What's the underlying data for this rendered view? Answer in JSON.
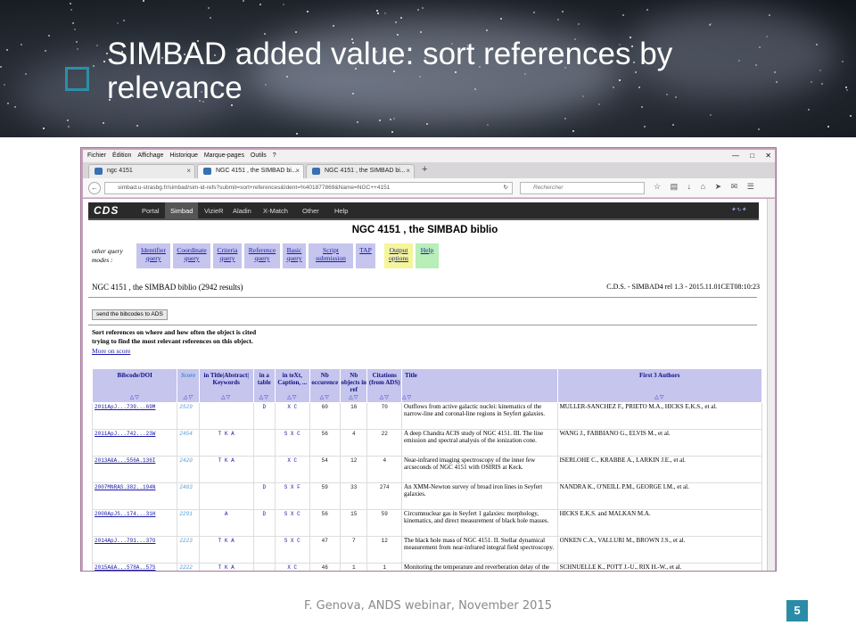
{
  "slide": {
    "title": "SIMBAD added value: sort references by relevance",
    "footer": "F. Genova, ANDS webinar, November 2015",
    "page_number": "5"
  },
  "browser": {
    "menu": [
      "Fichier",
      "Édition",
      "Affichage",
      "Historique",
      "Marque-pages",
      "Outils",
      "?"
    ],
    "tabs": [
      {
        "label": "ngc 4151",
        "active": false
      },
      {
        "label": "NGC 4151 , the SIMBAD bi...",
        "active": true
      },
      {
        "label": "NGC 4151 , the SIMBAD bi...",
        "active": false
      }
    ],
    "url": "simbad.u-strasbg.fr/simbad/sim-id-refs?submit=sort+references&Ident=%401877869&Name=NGC++4151",
    "search_placeholder": "Rechercher"
  },
  "simbad": {
    "logo": "CDS",
    "nav": [
      "Portal",
      "Simbad",
      "VizieR",
      "Aladin",
      "X-Match",
      "Other",
      "Help"
    ],
    "page_title": "NGC 4151 , the SIMBAD biblio",
    "other_modes_label": "other query modes :",
    "query_modes": [
      {
        "label": "Identifier query",
        "color": "#c5c5ee"
      },
      {
        "label": "Coordinate query",
        "color": "#c5c5ee"
      },
      {
        "label": "Criteria query",
        "color": "#c5c5ee"
      },
      {
        "label": "Reference query",
        "color": "#c5c5ee"
      },
      {
        "label": "Basic query",
        "color": "#c5c5ee"
      },
      {
        "label": "Script submission",
        "color": "#c5c5ee"
      },
      {
        "label": "TAP",
        "color": "#c5c5ee"
      },
      {
        "label": "Output options",
        "color": "#f5f59a"
      },
      {
        "label": "Help",
        "color": "#b8eeb8"
      }
    ],
    "result_heading": "NGC 4151 , the SIMBAD biblio (2942 results)",
    "version": "C.D.S. - SIMBAD4 rel 1.3 - 2015.11.01CET08:10:23",
    "ads_button": "send the bibcodes to ADS",
    "sort_note_1": "Sort references on where and how often the object is cited",
    "sort_note_2": "trying to find the most relevant references on this object.",
    "more_on_score": "More on score",
    "columns": [
      "Bibcode/DOI",
      "Score",
      "in Title|Abstract| Keywords",
      "in a table",
      "in teXt, Caption, ...",
      "Nb occurence",
      "Nb objects in ref",
      "Citations (from ADS)",
      "Title",
      "First 3 Authors"
    ],
    "sort_arrows": "△▽",
    "rows": [
      {
        "bibcode": "2011ApJ...739...69M",
        "score": "2529",
        "tak": "",
        "table": "D",
        "xc": "X C",
        "occ": "60",
        "objs": "16",
        "cit": "70",
        "title": "Outflows from active galactic nuclei: kinematics of the narrow-line and coronal-line regions in Seyfert galaxies.",
        "authors": "MULLER-SANCHEZ F., PRIETO M.A., HICKS E.K.S., et al."
      },
      {
        "bibcode": "2011ApJ...742...23W",
        "score": "2454",
        "tak": "T K A",
        "table": "",
        "xc": "S X C",
        "occ": "56",
        "objs": "4",
        "cit": "22",
        "title": "A deep Chandra ACIS study of NGC 4151. III. The line emission and spectral analysis of the ionization cone.",
        "authors": "WANG J., FABBIANO G., ELVIS M., et al."
      },
      {
        "bibcode": "2013A&A...556A.136I",
        "score": "2420",
        "tak": "T K A",
        "table": "",
        "xc": "X C",
        "occ": "54",
        "objs": "12",
        "cit": "4",
        "title": "Near-infrared imaging spectroscopy of the inner few arcseconds of NGC 4151 with OSIRIS at Keck.",
        "authors": "ISERLOHE C., KRABBE A., LARKIN J.E., et al."
      },
      {
        "bibcode": "2007MNRAS.382..194N",
        "score": "2403",
        "tak": "",
        "table": "D",
        "xc": "S X F",
        "occ": "59",
        "objs": "33",
        "cit": "274",
        "title": "An XMM-Newton survey of broad iron lines in Seyfert galaxies.",
        "authors": "NANDRA K., O'NEILL P.M., GEORGE I.M., et al."
      },
      {
        "bibcode": "2008ApJS..174...31H",
        "score": "2291",
        "tak": "A",
        "table": "D",
        "xc": "S X C",
        "occ": "56",
        "objs": "15",
        "cit": "59",
        "title": "Circumnuclear gas in Seyfert 1 galaxies: morphology, kinematics, and direct measurement of black hole masses.",
        "authors": "HICKS E.K.S. and MALKAN M.A."
      },
      {
        "bibcode": "2014ApJ...791...37O",
        "score": "2223",
        "tak": "T K A",
        "table": "",
        "xc": "S X C",
        "occ": "47",
        "objs": "7",
        "cit": "12",
        "title": "The black hole mass of NGC 4151. II. Stellar dynamical measurement from near-infrared integral field spectroscopy.",
        "authors": "ONKEN C.A., VALLURI M., BROWN J.S., et al."
      },
      {
        "bibcode": "2015A&A...578A..57S",
        "score": "2222",
        "tak": "T K A",
        "table": "",
        "xc": "X C",
        "occ": "46",
        "objs": "1",
        "cit": "1",
        "title": "Monitoring the temperature and reverberation delay of the circumnuclear hot dust in NGC",
        "authors": "SCHNUELLE K., POTT J.-U., RIX H.-W., et al."
      }
    ]
  }
}
